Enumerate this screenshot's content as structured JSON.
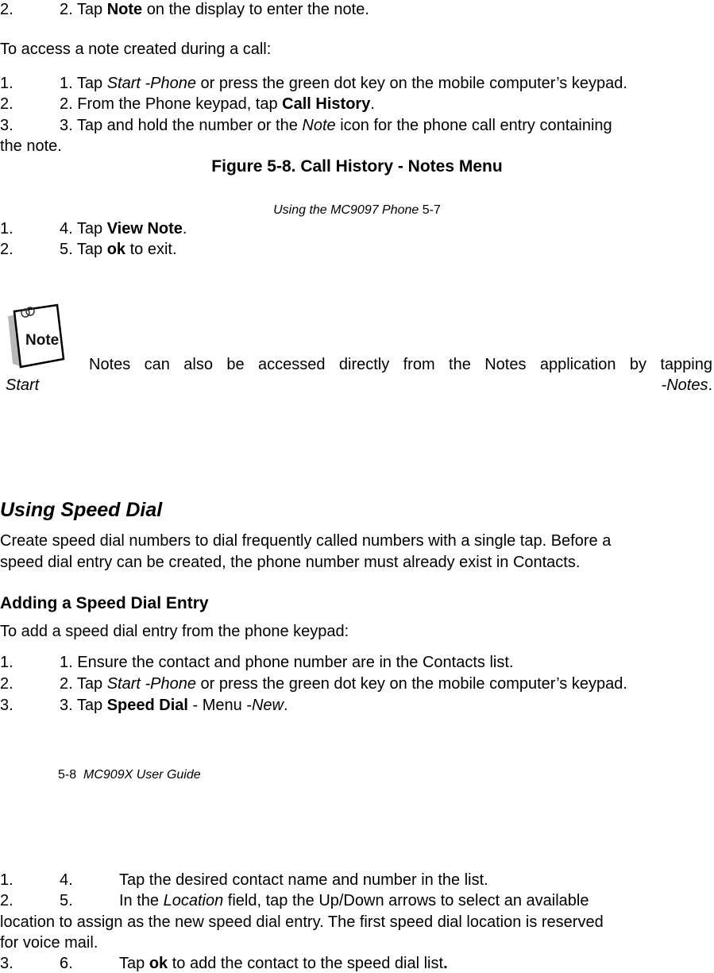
{
  "top_steps": {
    "step2": {
      "num": "2.",
      "text_pre": "2. Tap ",
      "bold": "Note",
      "text_post": " on the display to enter the note."
    }
  },
  "access_intro": "To access a note created during a call:",
  "access_steps": [
    {
      "num": "1.",
      "pre": "1. Tap ",
      "italic": "Start -Phone",
      "post": " or press the green dot key on the mobile computer’s keypad."
    },
    {
      "num": "2.",
      "pre": "2. From the Phone keypad, tap ",
      "bold": "Call History",
      "post": "."
    },
    {
      "num": "3.",
      "pre": "3. Tap and hold the number or the ",
      "italic": "Note",
      "post": " icon for the phone call entry containing",
      "continuation": "the note."
    }
  ],
  "figure_caption": "Figure 5-8. Call History - Notes Menu",
  "page_header": {
    "italic": "Using the MC9097 Phone",
    "page": " 5-7"
  },
  "more_steps": [
    {
      "num": "1.",
      "pre": "4. Tap ",
      "bold": "View Note",
      "post": "."
    },
    {
      "num": "2.",
      "pre": "5. Tap ",
      "bold": "ok",
      "post": " to exit."
    }
  ],
  "note": {
    "icon_label": "Note",
    "line1": "Notes can also be accessed directly from the Notes application by tapping",
    "line2_left": "Start",
    "line2_right": "-Notes",
    "line2_end": "."
  },
  "speed_dial": {
    "heading": "Using Speed Dial",
    "para_line1": "Create speed dial numbers to dial frequently called numbers with a single tap. Before a",
    "para_line2": "speed dial entry can be created, the phone number must already exist in Contacts."
  },
  "adding_entry": {
    "heading": "Adding a Speed Dial Entry",
    "intro": "To add a speed dial entry from the phone keypad:",
    "steps": [
      {
        "num": "1.",
        "pre": "1. Ensure the contact and phone number are in the Contacts list."
      },
      {
        "num": "2.",
        "pre": "2. Tap ",
        "italic": "Start -Phone",
        "post": " or press the green dot key on the mobile computer’s keypad."
      },
      {
        "num": "3.",
        "pre": "3. Tap ",
        "bold": "Speed Dial",
        "mid": " - Menu -",
        "italic": "New",
        "post": "."
      }
    ]
  },
  "page_footer": {
    "page": "5-8",
    "italic": "MC909X User Guide"
  },
  "final_steps": [
    {
      "num": "1.",
      "sub": "4.",
      "text": "Tap the desired contact name and number in the list."
    },
    {
      "num": "2.",
      "sub": "5.",
      "pre": "In the ",
      "italic": "Location",
      "post": " field, tap the Up/Down arrows to select an available",
      "cont1": "location to assign as the new speed dial entry. The first speed dial location is reserved",
      "cont2": "for voice mail."
    },
    {
      "num": "3.",
      "sub": "6.",
      "pre": "Tap ",
      "bold": "ok",
      "post": " to add the contact to the speed dial list",
      "end_bold": "."
    }
  ]
}
